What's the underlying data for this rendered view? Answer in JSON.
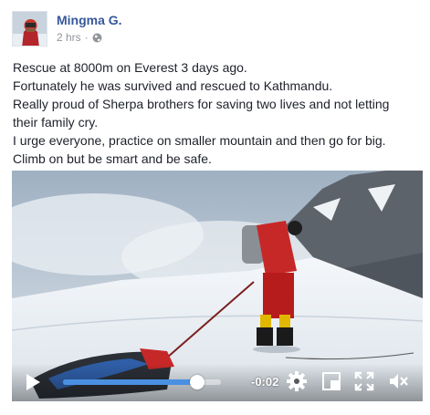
{
  "post": {
    "author_name": "Mingma G.",
    "timestamp": "2 hrs",
    "separator": "·",
    "privacy_icon": "globe-icon",
    "text_lines": [
      "Rescue at 8000m on Everest 3 days ago.",
      "Fortunately he was survived and rescued to Kathmandu.",
      "Really proud of Sherpa brothers for saving two lives and not letting",
      "their family cry.",
      "I urge everyone, practice on smaller mountain and then go for big.",
      "Climb on but be smart and be safe."
    ]
  },
  "video": {
    "remaining_time": "-0:02",
    "progress": 0.85,
    "icons": [
      "play-icon",
      "gear-icon",
      "square-icon",
      "fullscreen-icon",
      "mute-icon"
    ]
  },
  "colors": {
    "author": "#365899",
    "meta": "#90949c",
    "progress_fill": "#4a90e2"
  }
}
